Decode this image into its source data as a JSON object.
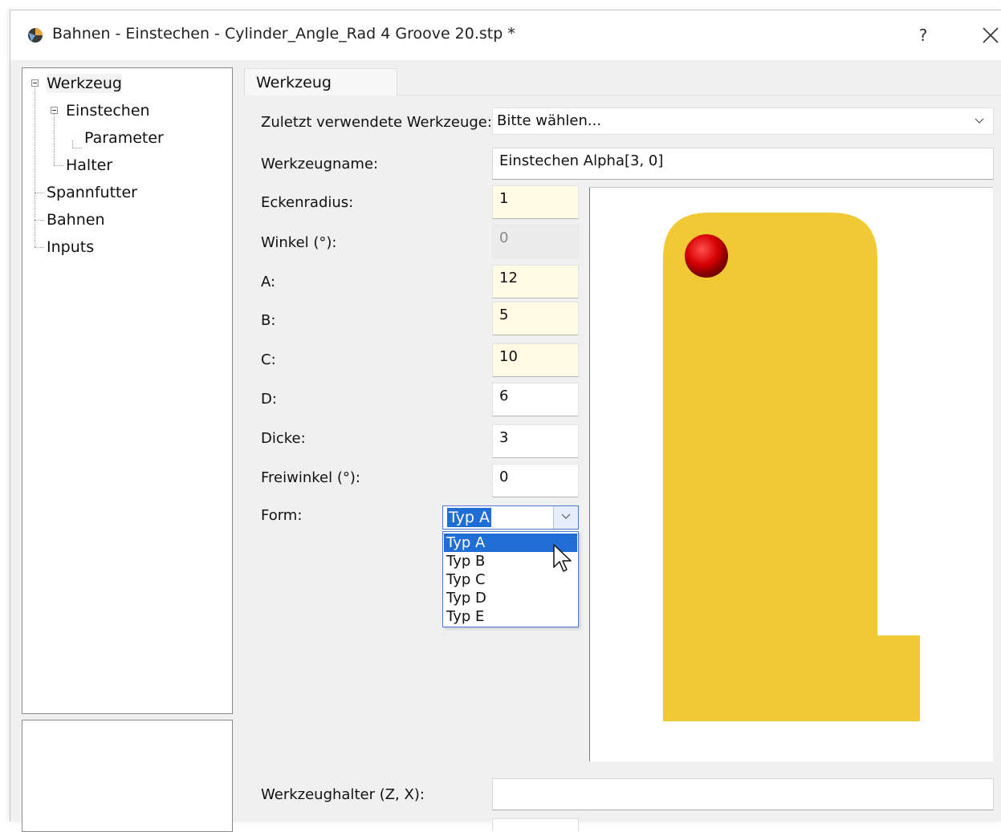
{
  "window": {
    "title": "Bahnen - Einstechen - Cylinder_Angle_Rad 4 Groove 20.stp *",
    "help_label": "?",
    "close_label": "✕"
  },
  "tree": {
    "items": [
      {
        "label": "Werkzeug"
      },
      {
        "label": "Einstechen"
      },
      {
        "label": "Parameter"
      },
      {
        "label": "Halter"
      },
      {
        "label": "Spannfutter"
      },
      {
        "label": "Bahnen"
      },
      {
        "label": "Inputs"
      }
    ]
  },
  "tab": {
    "label": "Werkzeug"
  },
  "form": {
    "recent_tools": {
      "label": "Zuletzt verwendete Werkzeuge:",
      "value": "Bitte wählen..."
    },
    "tool_name": {
      "label": "Werkzeugname:",
      "value": "Einstechen Alpha[3, 0]"
    },
    "corner_radius": {
      "label": "Eckenradius:",
      "value": "1"
    },
    "angle": {
      "label": "Winkel (°):",
      "value": "0"
    },
    "a": {
      "label": "A:",
      "value": "12"
    },
    "b": {
      "label": "B:",
      "value": "5"
    },
    "c": {
      "label": "C:",
      "value": "10"
    },
    "d": {
      "label": "D:",
      "value": "6"
    },
    "thickness": {
      "label": "Dicke:",
      "value": "3"
    },
    "clearance": {
      "label": "Freiwinkel  (°):",
      "value": "0"
    },
    "shape": {
      "label": "Form:",
      "selected": "Typ A",
      "options": [
        "Typ A",
        "Typ B",
        "Typ C",
        "Typ D",
        "Typ E"
      ]
    },
    "tool_holder": {
      "label": "Werkzeughalter (Z, X):",
      "value": ""
    }
  },
  "colors": {
    "tool_fill": "#f0c935",
    "marker": "#d60000",
    "selection": "#1f6ed5",
    "highlight_field": "#fffbe5"
  }
}
